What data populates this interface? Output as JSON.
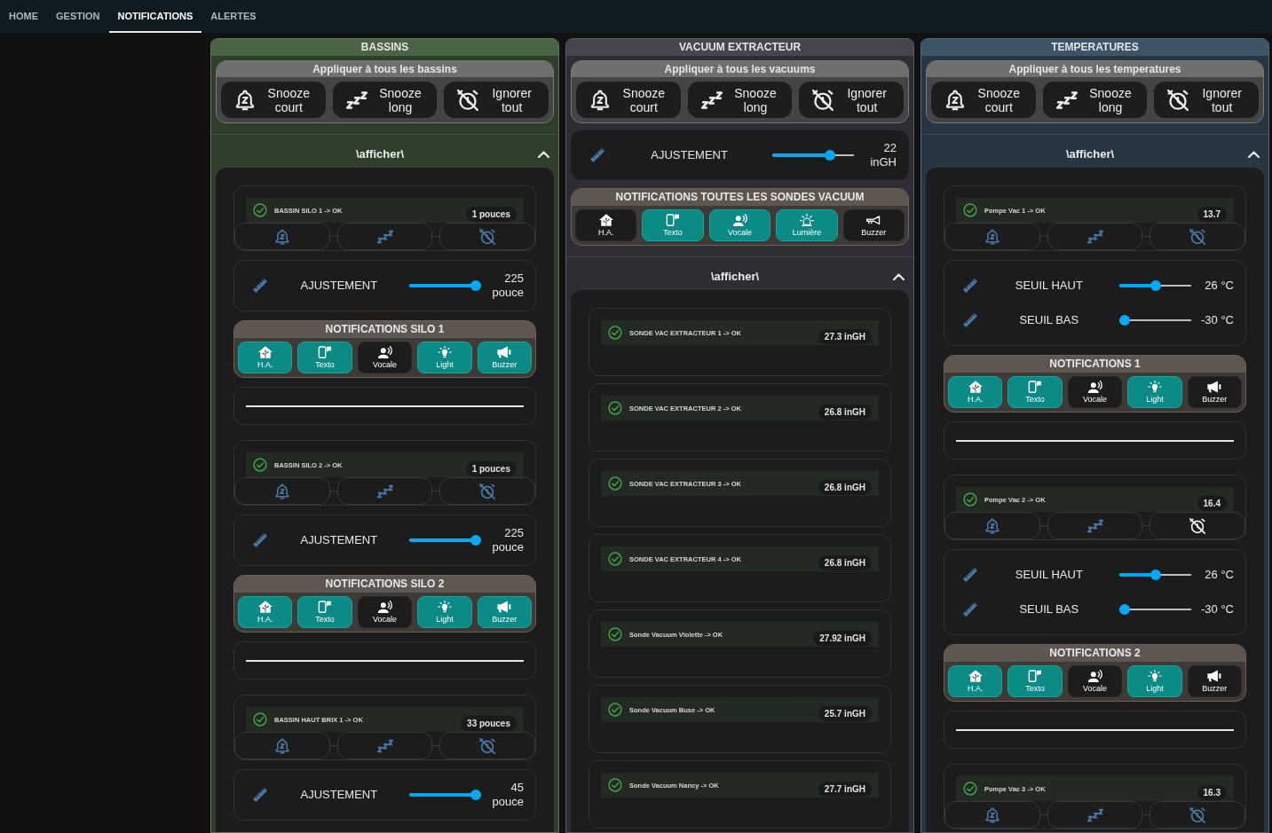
{
  "nav": {
    "tabs": [
      {
        "label": "HOME",
        "selected": false
      },
      {
        "label": "GESTION",
        "selected": false
      },
      {
        "label": "NOTIFICATIONS",
        "selected": true
      },
      {
        "label": "ALERTES",
        "selected": false
      }
    ]
  },
  "columns": [
    {
      "title": "BASSINS",
      "color": "#4a6345",
      "blocks": [
        {
          "kind": "apply",
          "title": "Appliquer à tous les bassins",
          "buttons": [
            {
              "kind": "snooze_short",
              "label": "Snooze court"
            },
            {
              "kind": "snooze_long",
              "label": "Snooze long"
            },
            {
              "kind": "ignore",
              "label": "Ignorer tout"
            }
          ]
        },
        {
          "kind": "section",
          "title": "\\afficher\\",
          "expanded": true,
          "items": [
            {
              "kind": "status",
              "label": "BASSIN SILO 1 -> OK",
              "value": "1 pouces",
              "actions": [
                {
                  "kind": "snooze_short",
                  "on": false
                },
                {
                  "kind": "snooze_long",
                  "on": false
                },
                {
                  "kind": "ignore",
                  "on": false
                }
              ]
            },
            {
              "kind": "sliders",
              "rows": [
                {
                  "label": "AJUSTEMENT",
                  "level": 1,
                  "reading": "225 pouce"
                }
              ]
            },
            {
              "kind": "notifications",
              "title": "NOTIFICATIONS SILO 1",
              "buttons": [
                {
                  "kind": "ha",
                  "label": "H.A.",
                  "on": true
                },
                {
                  "kind": "sms",
                  "label": "Texto",
                  "on": true
                },
                {
                  "kind": "voice",
                  "label": "Vocale",
                  "on": false
                },
                {
                  "kind": "light",
                  "label": "Light",
                  "on": true
                },
                {
                  "kind": "megaphone",
                  "label": "Buzzer",
                  "on": true
                }
              ]
            },
            {
              "kind": "divider"
            },
            {
              "kind": "status",
              "label": "BASSIN SILO 2 -> OK",
              "value": "1 pouces",
              "actions": [
                {
                  "kind": "snooze_short",
                  "on": false
                },
                {
                  "kind": "snooze_long",
                  "on": false
                },
                {
                  "kind": "ignore",
                  "on": false
                }
              ]
            },
            {
              "kind": "sliders",
              "rows": [
                {
                  "label": "AJUSTEMENT",
                  "level": 1,
                  "reading": "225 pouce"
                }
              ]
            },
            {
              "kind": "notifications",
              "title": "NOTIFICATIONS SILO 2",
              "buttons": [
                {
                  "kind": "ha",
                  "label": "H.A.",
                  "on": true
                },
                {
                  "kind": "sms",
                  "label": "Texto",
                  "on": true
                },
                {
                  "kind": "voice",
                  "label": "Vocale",
                  "on": false
                },
                {
                  "kind": "light",
                  "label": "Light",
                  "on": true
                },
                {
                  "kind": "megaphone",
                  "label": "Buzzer",
                  "on": true
                }
              ]
            },
            {
              "kind": "divider"
            },
            {
              "kind": "status",
              "label": "BASSIN HAUT BRIX 1 -> OK",
              "value": "33 pouces",
              "actions": [
                {
                  "kind": "snooze_short",
                  "on": false
                },
                {
                  "kind": "snooze_long",
                  "on": false
                },
                {
                  "kind": "ignore",
                  "on": false
                }
              ]
            },
            {
              "kind": "sliders",
              "rows": [
                {
                  "label": "AJUSTEMENT",
                  "level": 1,
                  "reading": "45 pouce"
                }
              ]
            }
          ]
        }
      ]
    },
    {
      "title": "VACUUM EXTRACTEUR",
      "color": "#46464f",
      "blocks": [
        {
          "kind": "apply",
          "title": "Appliquer à tous les vacuums",
          "buttons": [
            {
              "kind": "snooze_short",
              "label": "Snooze court"
            },
            {
              "kind": "snooze_long",
              "label": "Snooze long"
            },
            {
              "kind": "ignore",
              "label": "Ignorer tout"
            }
          ]
        },
        {
          "kind": "sliders",
          "rows": [
            {
              "label": "AJUSTEMENT",
              "level": 0.74,
              "reading": "22 inGH"
            }
          ]
        },
        {
          "kind": "notifications",
          "title": "NOTIFICATIONS TOUTES LES SONDES VACUUM",
          "buttons": [
            {
              "kind": "ha",
              "label": "H.A.",
              "on": false
            },
            {
              "kind": "sms",
              "label": "Texto",
              "on": true
            },
            {
              "kind": "voice",
              "label": "Vocale",
              "on": true
            },
            {
              "kind": "siren",
              "label": "Lumière",
              "on": true
            },
            {
              "kind": "horn",
              "label": "Buzzer",
              "on": false
            }
          ]
        },
        {
          "kind": "section",
          "title": "\\afficher\\",
          "expanded": true,
          "items": [
            {
              "kind": "status",
              "label": "SONDE VAC EXTRACTEUR 1 -> OK",
              "value": "27.3 inGH"
            },
            {
              "kind": "status",
              "label": "SONDE VAC EXTRACTEUR 2 -> OK",
              "value": "26.8 inGH"
            },
            {
              "kind": "status",
              "label": "SONDE VAC EXTRACTEUR 3 -> OK",
              "value": "26.8 inGH"
            },
            {
              "kind": "status",
              "label": "SONDE VAC EXTRACTEUR 4 -> OK",
              "value": "26.8 inGH"
            },
            {
              "kind": "status",
              "label": "Sonde Vacuum Violette -> OK",
              "value": "27.92 inGH"
            },
            {
              "kind": "status",
              "label": "Sonde Vacuum Buse -> OK",
              "value": "25.7 inGH"
            },
            {
              "kind": "status",
              "label": "Sonde Vacuum Nancy -> OK",
              "value": "27.7 inGH"
            }
          ]
        }
      ]
    },
    {
      "title": "TEMPERATURES",
      "color": "#3d5466",
      "blocks": [
        {
          "kind": "apply",
          "title": "Appliquer à tous les temperatures",
          "buttons": [
            {
              "kind": "snooze_short",
              "label": "Snooze court"
            },
            {
              "kind": "snooze_long",
              "label": "Snooze long"
            },
            {
              "kind": "ignore",
              "label": "Ignorer tout"
            }
          ]
        },
        {
          "kind": "section",
          "title": "\\afficher\\",
          "expanded": true,
          "items": [
            {
              "kind": "status",
              "label": "Pompe Vac 1 -> OK",
              "value": "13.7",
              "actions": [
                {
                  "kind": "snooze_short",
                  "on": false
                },
                {
                  "kind": "snooze_long",
                  "on": false
                },
                {
                  "kind": "ignore",
                  "on": false
                }
              ]
            },
            {
              "kind": "sliders",
              "rows": [
                {
                  "label": "SEUIL HAUT",
                  "level": 0.51,
                  "reading": "26 °C"
                },
                {
                  "label": "SEUIL BAS",
                  "level": 0,
                  "reading": "-30 °C"
                }
              ]
            },
            {
              "kind": "notifications",
              "title": "NOTIFICATIONS 1",
              "buttons": [
                {
                  "kind": "ha",
                  "label": "H.A.",
                  "on": true
                },
                {
                  "kind": "sms",
                  "label": "Texto",
                  "on": true
                },
                {
                  "kind": "voice",
                  "label": "Vocale",
                  "on": false
                },
                {
                  "kind": "light",
                  "label": "Light",
                  "on": true
                },
                {
                  "kind": "megaphone",
                  "label": "Buzzer",
                  "on": false
                }
              ]
            },
            {
              "kind": "divider"
            },
            {
              "kind": "status",
              "label": "Pompe Vac 2 -> OK",
              "value": "16.4",
              "actions": [
                {
                  "kind": "snooze_short",
                  "on": false
                },
                {
                  "kind": "snooze_long",
                  "on": false
                },
                {
                  "kind": "ignore",
                  "on": true
                }
              ]
            },
            {
              "kind": "sliders",
              "rows": [
                {
                  "label": "SEUIL HAUT",
                  "level": 0.51,
                  "reading": "26 °C"
                },
                {
                  "label": "SEUIL BAS",
                  "level": 0,
                  "reading": "-30 °C"
                }
              ]
            },
            {
              "kind": "notifications",
              "title": "NOTIFICATIONS 2",
              "buttons": [
                {
                  "kind": "ha",
                  "label": "H.A.",
                  "on": true
                },
                {
                  "kind": "sms",
                  "label": "Texto",
                  "on": true
                },
                {
                  "kind": "voice",
                  "label": "Vocale",
                  "on": false
                },
                {
                  "kind": "light",
                  "label": "Light",
                  "on": true
                },
                {
                  "kind": "megaphone",
                  "label": "Buzzer",
                  "on": false
                }
              ]
            },
            {
              "kind": "divider"
            },
            {
              "kind": "status",
              "label": "Pompe Vac 3 -> OK",
              "value": "16.3",
              "actions": [
                {
                  "kind": "snooze_short",
                  "on": false
                },
                {
                  "kind": "snooze_long",
                  "on": false
                },
                {
                  "kind": "ignore",
                  "on": false
                }
              ]
            }
          ]
        }
      ]
    }
  ]
}
